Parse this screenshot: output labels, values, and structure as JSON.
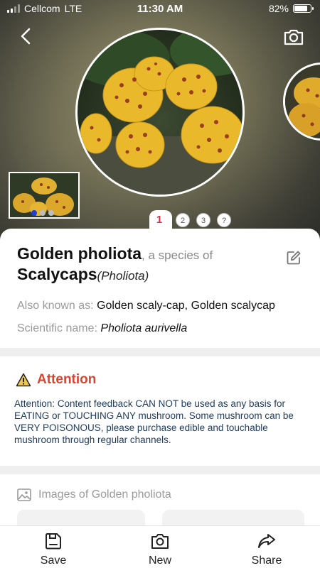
{
  "status_bar": {
    "carrier": "Cellcom",
    "network": "LTE",
    "time": "11:30 AM",
    "battery": "82%",
    "battery_level": 0.82
  },
  "pager": {
    "pages": [
      "1",
      "2",
      "3",
      "?"
    ],
    "active_index": 0
  },
  "species": {
    "common_name": "Golden pholiota",
    "species_of": ", a species of",
    "genus": "Scalycaps",
    "genus_latin": "(Pholiota)"
  },
  "details": {
    "aka_label": "Also known as:",
    "aka_value": "Golden scaly-cap, Golden scalycap",
    "scientific_label": "Scientific name:",
    "scientific_value": "Pholiota aurivella"
  },
  "attention": {
    "title": "Attention",
    "text": "Attention: Content feedback CAN NOT be used as any basis for EATING or TOUCHING ANY mushroom. Some mushroom can be VERY POISONOUS, please purchase edible and touchable mushroom through regular channels."
  },
  "images_section": {
    "title": "Images of Golden pholiota"
  },
  "tabbar": {
    "save": "Save",
    "new": "New",
    "share": "Share"
  },
  "icons": [
    "back-icon",
    "camera-icon",
    "edit-icon",
    "warning-icon",
    "image-icon",
    "save-icon",
    "camera-new-icon",
    "share-icon"
  ],
  "colors": {
    "accent": "#d9304a",
    "attention": "#d9452f",
    "warning_body": "#1e3a5f",
    "dot_active": "#1d3fd6"
  }
}
